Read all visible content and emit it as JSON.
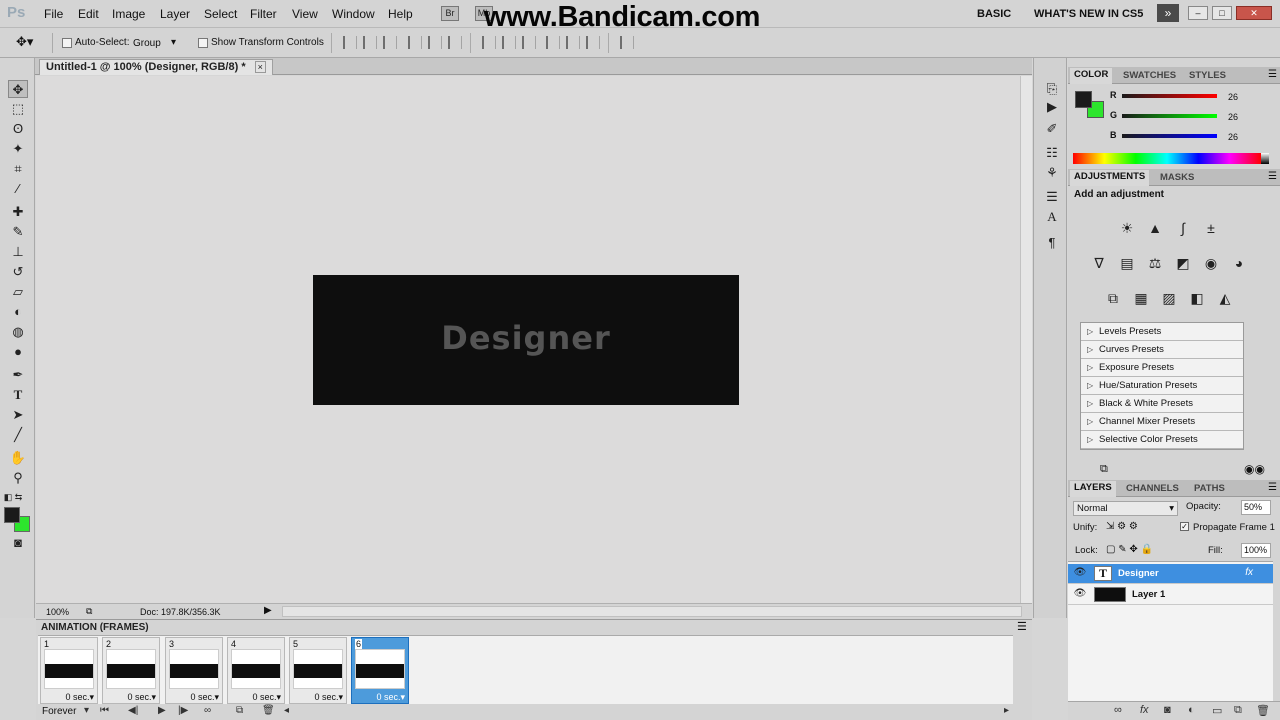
{
  "app": {
    "logo": "Ps"
  },
  "menu": [
    "File",
    "Edit",
    "Image",
    "Layer",
    "Select",
    "Filter",
    "View",
    "Window",
    "Help"
  ],
  "bridge_buttons": [
    "Br",
    "Mb"
  ],
  "watermark": "www.Bandicam.com",
  "workspaces": {
    "basic": "BASIC",
    "whats_new": "WHAT'S NEW IN CS5",
    "more": "»"
  },
  "options": {
    "auto_select_label": "Auto-Select:",
    "auto_select_value": "Group",
    "show_transform_label": "Show Transform Controls"
  },
  "document": {
    "tab_title": "Untitled-1 @ 100% (Designer, RGB/8) *",
    "close": "×",
    "canvas_text": "Designer",
    "canvas_color": "#0e0e0e"
  },
  "status": {
    "zoom": "100%",
    "doc_size": "Doc: 197.8K/356.3K"
  },
  "animation": {
    "title": "ANIMATION (FRAMES)",
    "frames": [
      {
        "num": "1",
        "delay": "0 sec.▾"
      },
      {
        "num": "2",
        "delay": "0 sec.▾"
      },
      {
        "num": "3",
        "delay": "0 sec.▾"
      },
      {
        "num": "4",
        "delay": "0 sec.▾"
      },
      {
        "num": "5",
        "delay": "0 sec.▾"
      },
      {
        "num": "6",
        "delay": "0 sec.▾"
      }
    ],
    "selected_frame": 6,
    "loop": "Forever"
  },
  "color_panel": {
    "tabs": [
      "COLOR",
      "SWATCHES",
      "STYLES"
    ],
    "r_label": "R",
    "g_label": "G",
    "b_label": "B",
    "r": "26",
    "g": "26",
    "b": "26",
    "fg_color": "#1a1a1a",
    "bg_color": "#2de52d"
  },
  "adjustments_panel": {
    "tabs": [
      "ADJUSTMENTS",
      "MASKS"
    ],
    "heading": "Add an adjustment",
    "presets": [
      "Levels Presets",
      "Curves Presets",
      "Exposure Presets",
      "Hue/Saturation Presets",
      "Black & White Presets",
      "Channel Mixer Presets",
      "Selective Color Presets"
    ]
  },
  "layers_panel": {
    "tabs": [
      "LAYERS",
      "CHANNELS",
      "PATHS"
    ],
    "blend_mode": "Normal",
    "opacity_label": "Opacity:",
    "opacity": "50%",
    "unify_label": "Unify:",
    "propagate_label": "Propagate Frame 1",
    "lock_label": "Lock:",
    "fill_label": "Fill:",
    "fill": "100%",
    "layers": [
      {
        "name": "Designer",
        "type": "text",
        "selected": true,
        "fx": "fx"
      },
      {
        "name": "Layer 1",
        "type": "raster",
        "selected": false
      }
    ]
  },
  "accent_color": "#3e8fe0"
}
